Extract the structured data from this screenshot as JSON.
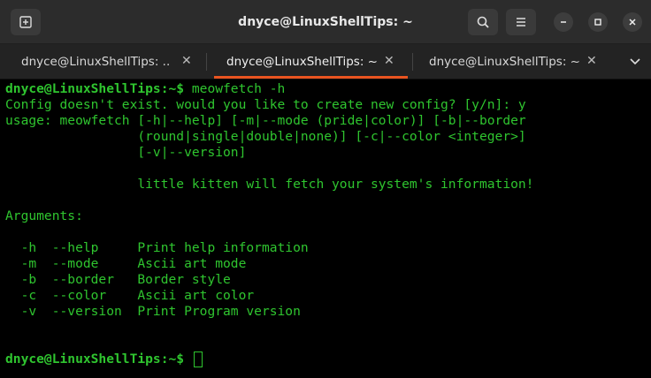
{
  "window": {
    "title": "dnyce@LinuxShellTips: ~"
  },
  "tabs": [
    {
      "label": "dnyce@LinuxShellTips: ...",
      "active": false
    },
    {
      "label": "dnyce@LinuxShellTips: ~",
      "active": true
    },
    {
      "label": "dnyce@LinuxShellTips: ~",
      "active": false
    }
  ],
  "icons": {
    "new_tab": "new-tab-icon",
    "search": "search-icon",
    "menu": "hamburger-menu-icon",
    "minimize": "minimize-icon",
    "maximize": "maximize-icon",
    "close": "close-icon",
    "tab_close": "close-icon",
    "tabs_dropdown": "chevron-down-icon"
  },
  "colors": {
    "terminal_text": "#2fc52f",
    "terminal_bg": "#000000",
    "active_tab_accent": "#e95420"
  },
  "terminal": {
    "prompt": "dnyce@LinuxShellTips:~$",
    "command": " meowfetch -h",
    "lines": [
      "Config doesn't exist. would you like to create new config? [y/n]: y",
      "usage: meowfetch [-h|--help] [-m|--mode (pride|color)] [-b|--border",
      "                 (round|single|double|none)] [-c|--color <integer>]",
      "                 [-v|--version]",
      "",
      "                 little kitten will fetch your system's information!",
      "",
      "Arguments:",
      "",
      "  -h  --help     Print help information",
      "  -m  --mode     Ascii art mode",
      "  -b  --border   Border style",
      "  -c  --color    Ascii art color",
      "  -v  --version  Print Program version"
    ],
    "final_prompt": "dnyce@LinuxShellTips:~$",
    "final_input": " "
  }
}
